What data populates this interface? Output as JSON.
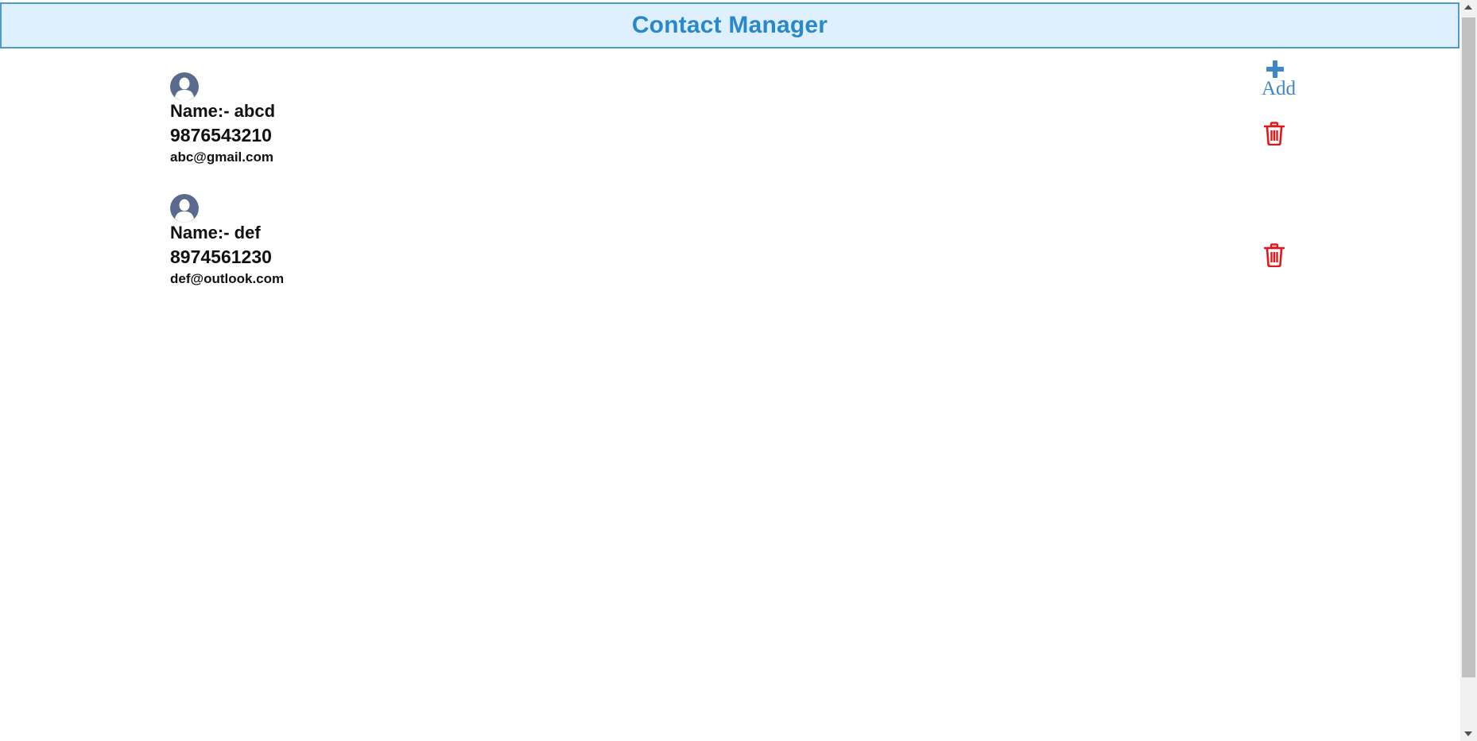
{
  "header": {
    "title": "Contact Manager"
  },
  "toolbar": {
    "add_label": "Add",
    "add_icon": "plus-icon"
  },
  "contacts": [
    {
      "name": "Name:- abcd",
      "phone": "9876543210",
      "email": "abc@gmail.com",
      "avatar_icon": "user-avatar-icon",
      "delete_icon": "trash-icon"
    },
    {
      "name": "Name:- def",
      "phone": "8974561230",
      "email": "def@outlook.com",
      "avatar_icon": "user-avatar-icon",
      "delete_icon": "trash-icon"
    }
  ],
  "colors": {
    "header_bg": "#def0fd",
    "header_border": "#4d9bd2",
    "title": "#2a87c9",
    "add": "#3f86c8",
    "delete": "#e3171b",
    "avatar": "#5a6a8c"
  }
}
